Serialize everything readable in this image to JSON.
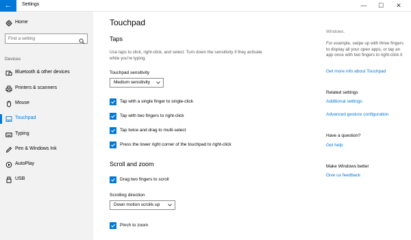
{
  "window": {
    "title": "Settings",
    "back_glyph": "←",
    "minimize_glyph": "—",
    "maximize_glyph": "☐",
    "close_glyph": "✕",
    "accent_color": "#0078d7"
  },
  "sidebar": {
    "home_label": "Home",
    "search_placeholder": "Find a setting",
    "section_label": "Devices",
    "items": [
      {
        "label": "Bluetooth & other devices",
        "icon": "bluetooth-icon"
      },
      {
        "label": "Printers & scanners",
        "icon": "printer-icon"
      },
      {
        "label": "Mouse",
        "icon": "mouse-icon"
      },
      {
        "label": "Touchpad",
        "icon": "touchpad-icon",
        "active": true
      },
      {
        "label": "Typing",
        "icon": "keyboard-icon"
      },
      {
        "label": "Pen & Windows Ink",
        "icon": "pen-icon"
      },
      {
        "label": "AutoPlay",
        "icon": "autoplay-icon"
      },
      {
        "label": "USB",
        "icon": "usb-icon"
      }
    ]
  },
  "main": {
    "title": "Touchpad",
    "taps_heading": "Taps",
    "taps_description": "Use taps to click, right-click, and select. Turn down the sensitivity if they activate while you're typing",
    "sensitivity_label": "Touchpad sensitivity",
    "sensitivity_value": "Medium sensitivity",
    "tap_options": [
      {
        "label": "Tap with a single finger to single-click",
        "checked": true
      },
      {
        "label": "Tap with two fingers to right-click",
        "checked": true
      },
      {
        "label": "Tap twice and drag to multi-select",
        "checked": true
      },
      {
        "label": "Press the lower right corner of the touchpad to right-click",
        "checked": true
      }
    ],
    "scroll_heading": "Scroll and zoom",
    "drag_scroll_label": "Drag two fingers to scroll",
    "scrolling_direction_label": "Scrolling direction",
    "scrolling_direction_value": "Down motion scrolls up",
    "pinch_zoom_label": "Pinch to zoom"
  },
  "right": {
    "windows_label": "Windows.",
    "example_text": "For example, swipe up with three fingers to display all your open apps, or tap an app once with two fingers to right-click it",
    "more_info_link": "Get more info about Touchpad",
    "related_heading": "Related settings",
    "additional_link": "Additional settings",
    "advanced_link": "Advanced gesture configuration",
    "question_heading": "Have a question?",
    "help_link": "Get help",
    "better_heading": "Make Windows better",
    "feedback_link": "Give us feedback"
  }
}
